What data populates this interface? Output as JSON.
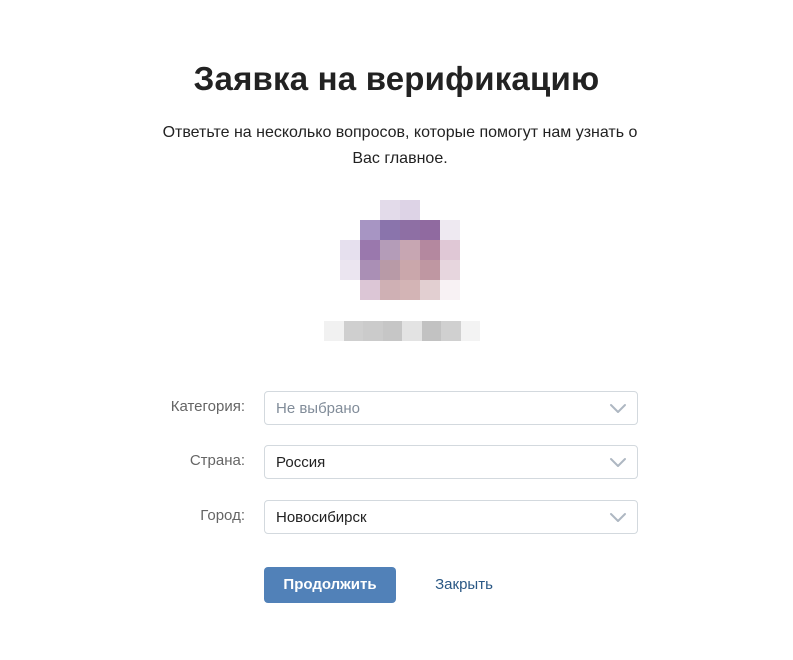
{
  "page": {
    "title": "Заявка на верификацию",
    "subtitle": "Ответьте на несколько вопросов, которые помогут нам узнать о Вас главное."
  },
  "profile": {
    "avatar_icon": "pixelated-avatar",
    "avatar_pixels": [
      "#ffffff",
      "#ffffff",
      "#e3dbea",
      "#ddd3e6",
      "#ffffff",
      "#ffffff",
      "#ffffff",
      "#a795c3",
      "#8a74ac",
      "#8e6fa4",
      "#906aa0",
      "#eee9f1",
      "#e6e0ee",
      "#9a78ad",
      "#b49cb8",
      "#c7a6b2",
      "#b4889f",
      "#e0c8d6",
      "#ebe5f0",
      "#aa8fb5",
      "#b89aa7",
      "#caa7ab",
      "#bf97a2",
      "#e7d6de",
      "#ffffff",
      "#dcc6d6",
      "#cfb0b4",
      "#d3b4b5",
      "#e2cfd1",
      "#f8f2f4"
    ],
    "username_pixels": [
      "#f1f1f1",
      "#cfcfcf",
      "#cbcbcb",
      "#c6c6c6",
      "#e3e3e3",
      "#c2c2c2",
      "#d0d0d0",
      "#f3f3f3"
    ]
  },
  "form": {
    "category": {
      "label": "Категория:",
      "value": "Не выбрано",
      "is_placeholder": true,
      "icon": "chevron-down-icon"
    },
    "country": {
      "label": "Страна:",
      "value": "Россия",
      "icon": "chevron-down-icon"
    },
    "city": {
      "label": "Город:",
      "value": "Новосибирск",
      "icon": "chevron-down-icon"
    }
  },
  "actions": {
    "continue_label": "Продолжить",
    "close_label": "Закрыть"
  },
  "colors": {
    "primary": "#5181b8",
    "link": "#2a5885",
    "border": "#d3d9de",
    "label": "#656565",
    "placeholder": "#818c99",
    "chevron": "#aeb7c2"
  }
}
